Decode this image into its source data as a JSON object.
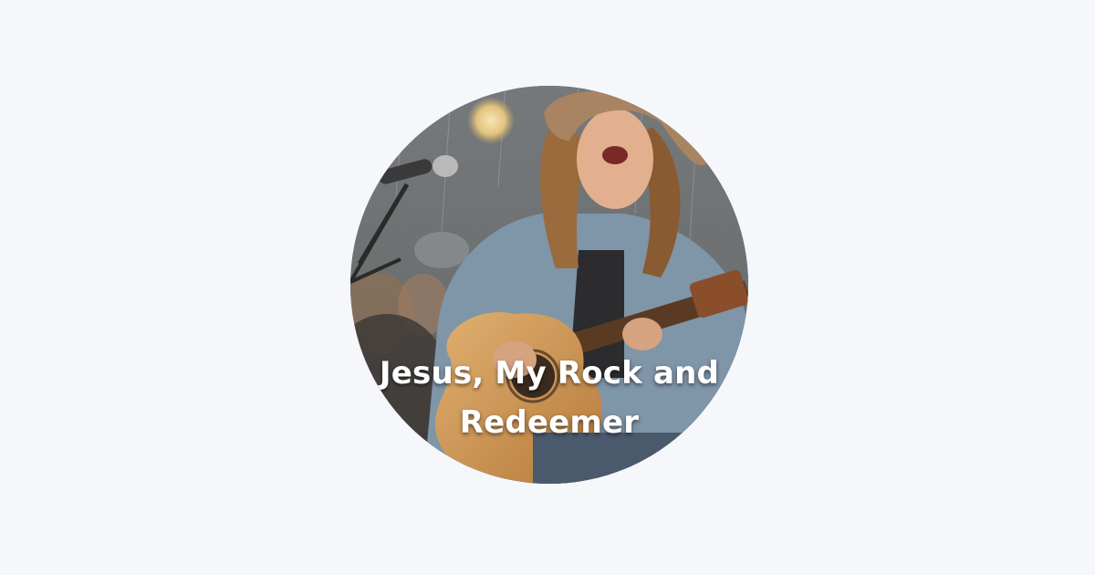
{
  "artwork": {
    "title_lines": [
      "Jesus, My Rock and",
      "Redeemer"
    ],
    "image_description_icon": "musician-photo"
  },
  "colors": {
    "background": "#f5f7fb",
    "title_text": "#ffffff"
  }
}
